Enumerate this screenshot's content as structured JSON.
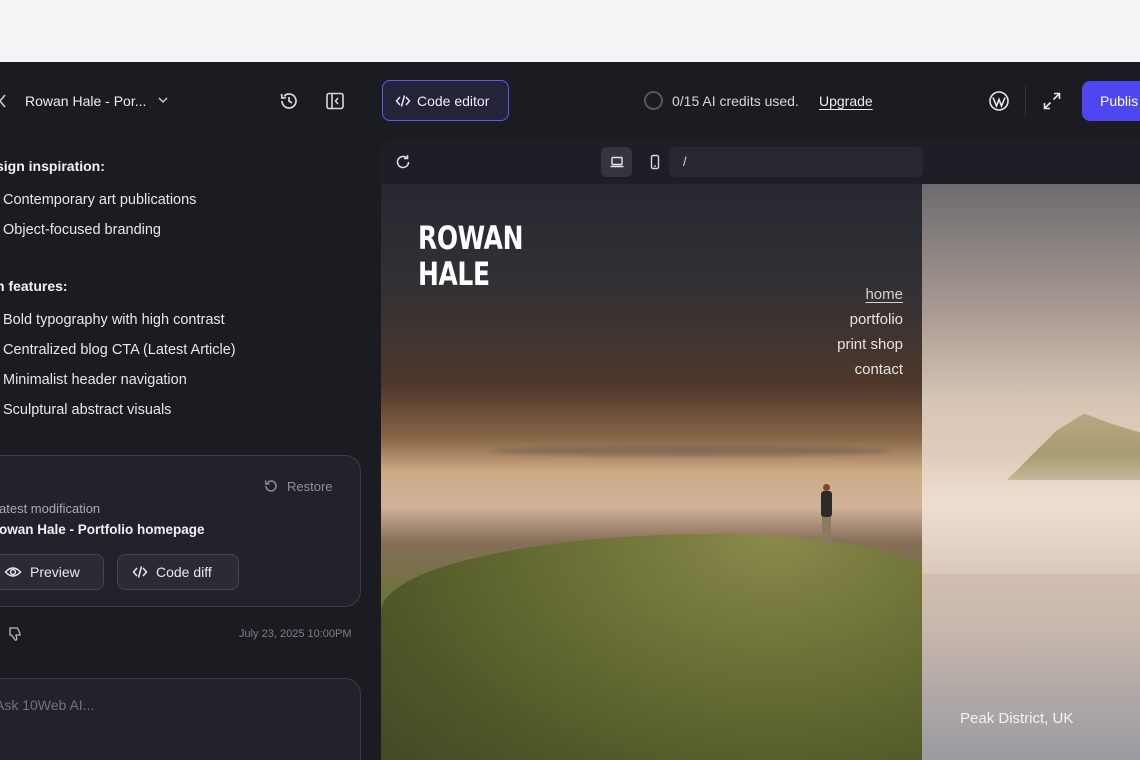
{
  "topbar": {
    "project_name": "Rowan Hale - Por...",
    "code_editor_label": "Code editor",
    "credits_text": "0/15 AI credits used.",
    "upgrade_label": "Upgrade",
    "publish_label": "Publis"
  },
  "chat": {
    "section1_title": "sign inspiration:",
    "section1_items": [
      "Contemporary art publications",
      "Object-focused branding"
    ],
    "section2_title": "n features:",
    "section2_items": [
      "Bold typography with high contrast",
      "Centralized blog CTA (Latest Article)",
      "Minimalist header navigation",
      "Sculptural abstract visuals"
    ],
    "card": {
      "restore_label": "Restore",
      "label": "atest modification",
      "title": "owan Hale - Portfolio homepage",
      "preview_label": "Preview",
      "code_diff_label": "Code diff"
    },
    "timestamp": "July 23, 2025 10:00PM",
    "ask_placeholder": "Ask 10Web AI..."
  },
  "preview": {
    "url": "/",
    "site": {
      "logo_line1": "ROWAN",
      "logo_line2": "HALE",
      "nav": [
        "home",
        "portfolio",
        "print shop",
        "contact"
      ],
      "caption": "Peak District, UK"
    }
  },
  "colors": {
    "accent": "#4f46f0",
    "panel_bg": "#1b1c22",
    "card_border": "#3b3c45"
  },
  "icons": [
    "chevron-left-icon",
    "chevron-down-icon",
    "history-icon",
    "sidebar-toggle-icon",
    "code-icon",
    "wordpress-icon",
    "expand-icon",
    "restore-icon",
    "eye-icon",
    "thumbs-down-icon",
    "reload-icon",
    "desktop-icon",
    "mobile-icon"
  ]
}
